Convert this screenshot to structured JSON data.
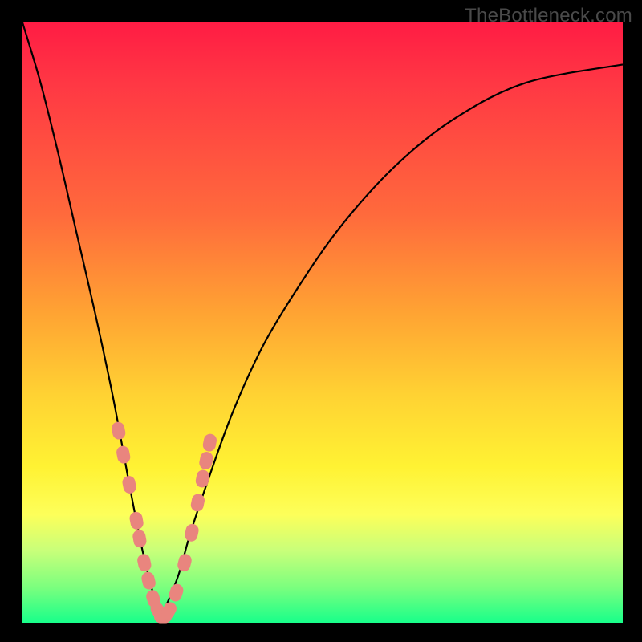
{
  "watermark": "TheBottleneck.com",
  "colors": {
    "frame": "#000000",
    "gradient_stops": [
      "#ff1c44",
      "#ff3744",
      "#ff6a3c",
      "#ffa233",
      "#ffd233",
      "#fff233",
      "#fdff5a",
      "#c8ff7a",
      "#7dff7e",
      "#18ff8a"
    ],
    "curve": "#000000",
    "markers": "#e9857e"
  },
  "chart_data": {
    "type": "line",
    "title": "",
    "xlabel": "",
    "ylabel": "",
    "xlim": [
      0,
      100
    ],
    "ylim": [
      0,
      100
    ],
    "grid": false,
    "legend": false,
    "note": "Bottleneck-style V curve: y is mismatch/bottleneck %, minimum ~0 near x≈23; rises steeply toward x=0 and more gently toward x=100. Values are estimated from the image.",
    "series": [
      {
        "name": "bottleneck-curve",
        "x": [
          0,
          3,
          6,
          9,
          12,
          15,
          18,
          20,
          22,
          23,
          24,
          26,
          28,
          31,
          35,
          40,
          46,
          53,
          62,
          72,
          84,
          100
        ],
        "y": [
          100,
          90,
          78,
          65,
          52,
          38,
          22,
          12,
          4,
          1,
          3,
          8,
          15,
          24,
          35,
          46,
          56,
          66,
          76,
          84,
          90,
          93
        ]
      }
    ],
    "markers": {
      "name": "highlighted-points",
      "note": "Pink capsule markers clustered on both flanks of the valley, roughly y∈[3,30].",
      "points": [
        {
          "x": 16.0,
          "y": 32
        },
        {
          "x": 16.8,
          "y": 28
        },
        {
          "x": 17.8,
          "y": 23
        },
        {
          "x": 19.0,
          "y": 17
        },
        {
          "x": 19.5,
          "y": 14
        },
        {
          "x": 20.3,
          "y": 10
        },
        {
          "x": 21.0,
          "y": 7
        },
        {
          "x": 21.8,
          "y": 4
        },
        {
          "x": 22.6,
          "y": 2
        },
        {
          "x": 23.4,
          "y": 1
        },
        {
          "x": 24.4,
          "y": 2
        },
        {
          "x": 25.6,
          "y": 5
        },
        {
          "x": 27.0,
          "y": 10
        },
        {
          "x": 28.2,
          "y": 15
        },
        {
          "x": 29.2,
          "y": 20
        },
        {
          "x": 30.0,
          "y": 24
        },
        {
          "x": 30.6,
          "y": 27
        },
        {
          "x": 31.2,
          "y": 30
        }
      ]
    }
  }
}
